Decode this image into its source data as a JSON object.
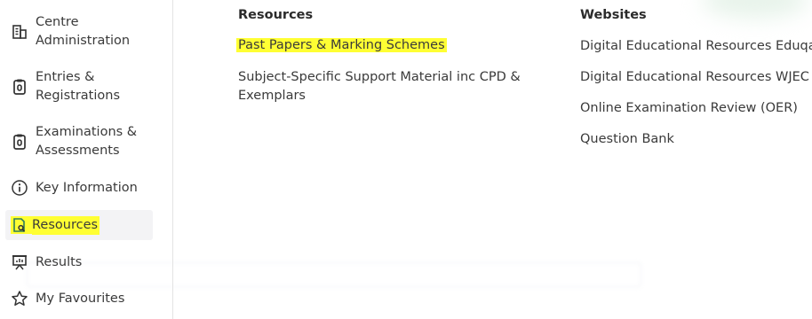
{
  "sidebar": {
    "items": [
      {
        "label_line1": "Centre",
        "label_line2": "Administration",
        "icon": "building-icon"
      },
      {
        "label_line1": "Entries &",
        "label_line2": "Registrations",
        "icon": "clipboard-icon"
      },
      {
        "label_line1": "Examinations &",
        "label_line2": "Assessments",
        "icon": "clipboard-icon"
      },
      {
        "label": "Key Information",
        "icon": "info-icon"
      },
      {
        "label": "Resources",
        "icon": "document-search-icon",
        "active": true
      },
      {
        "label": "Results",
        "icon": "presentation-chart-icon"
      },
      {
        "label": "My Favourites",
        "icon": "star-icon"
      }
    ]
  },
  "resources": {
    "title": "Resources",
    "links": [
      {
        "label": "Past Papers & Marking Schemes",
        "highlighted": true
      },
      {
        "label_line1": "Subject-Specific Support Material inc CPD &",
        "label_line2": "Exemplars"
      }
    ]
  },
  "websites": {
    "title": "Websites",
    "links": [
      "Digital Educational Resources Eduqas",
      "Digital Educational Resources WJEC",
      "Online Examination Review (OER)",
      "Question Bank"
    ]
  },
  "colors": {
    "highlight": "#ffff33",
    "active_bg": "#f3f3f5",
    "divider": "#e3e3e3",
    "text": "#3a3a3a"
  }
}
